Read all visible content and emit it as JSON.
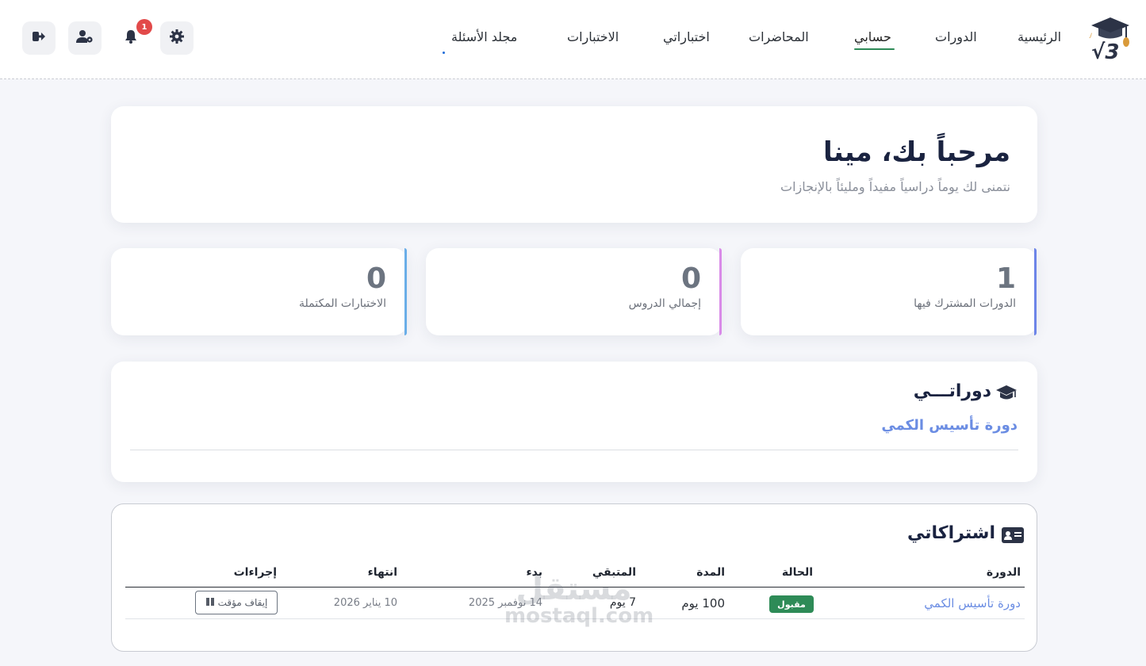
{
  "nav": {
    "items": [
      "الرئيسية",
      "الدورات",
      "حسابي",
      "المحاضرات",
      "اختباراتي",
      "الاختبارات",
      "مجلد الأسئلة"
    ],
    "active_index": 2,
    "notification_count": "1",
    "accent_color": "#2e8b57"
  },
  "welcome": {
    "title": "مرحباً بك، مينا",
    "subtitle": "نتمنى لك يوماً دراسياً مفيداً ومليئاً بالإنجازات"
  },
  "stats": [
    {
      "value": "1",
      "label": "الدورات المشترك فيها",
      "color": "#6d85e8"
    },
    {
      "value": "0",
      "label": "إجمالي الدروس",
      "color": "#d98be8"
    },
    {
      "value": "0",
      "label": "الاختبارات المكتملة",
      "color": "#6aaee8"
    }
  ],
  "courses": {
    "title": "دوراتـــي",
    "items": [
      "دورة تأسيس الكمي"
    ]
  },
  "subscriptions": {
    "title": "اشتراكاتي",
    "headers": [
      "الدورة",
      "الحالة",
      "المدة",
      "المتبقي",
      "بدء",
      "انتهاء",
      "إجراءات"
    ],
    "rows": [
      {
        "course": "دورة تأسيس الكمي",
        "status": "مقبول",
        "duration": "100 يوم",
        "remaining": "7 يوم",
        "start": "14 نوفمبر 2025",
        "end": "10 يناير 2026",
        "action": "إيقاف مؤقت"
      }
    ]
  },
  "watermark": {
    "arabic": "مستقل",
    "latin": "mostaql.com"
  }
}
